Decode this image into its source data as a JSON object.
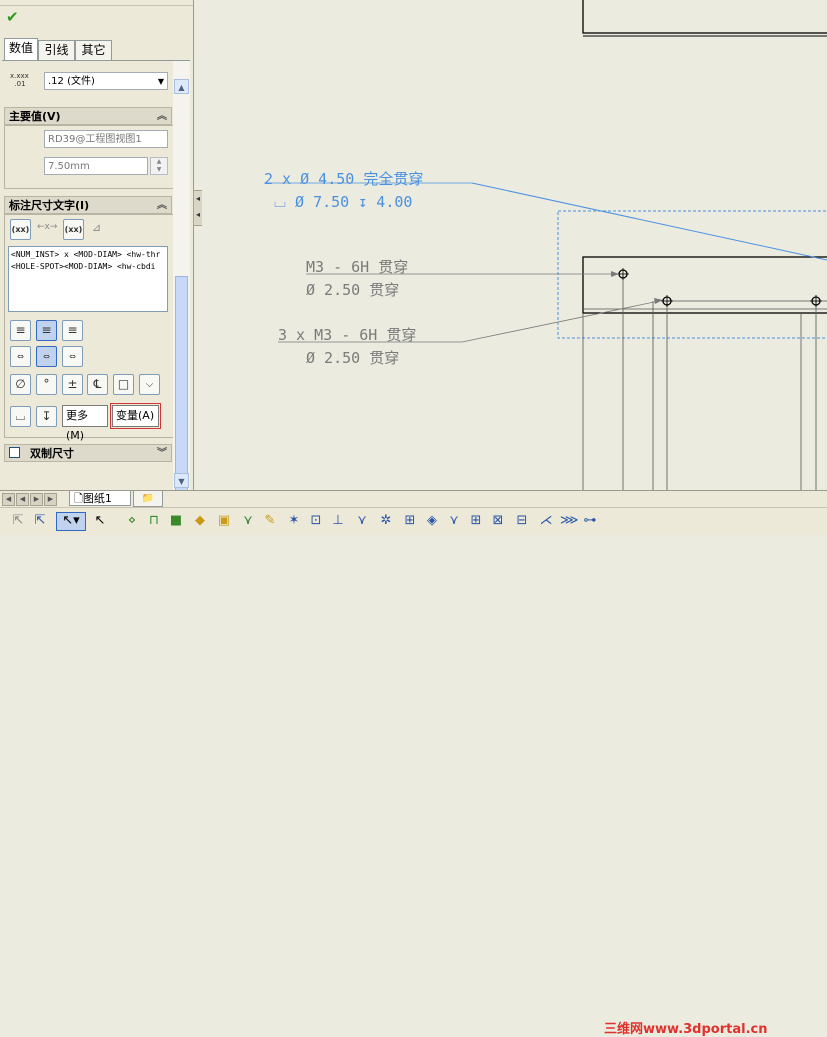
{
  "panel": {
    "tabs": [
      {
        "label": "数值",
        "active": true
      },
      {
        "label": "引线",
        "active": false
      },
      {
        "label": "其它",
        "active": false
      }
    ],
    "tolerance": {
      "icon_text": "x.xxx .01",
      "value": ".12 (文件)"
    },
    "primary_value": {
      "title": "主要值(V)",
      "reference": "RD39@工程图视图1",
      "value": "7.50mm"
    },
    "dim_text": {
      "title": "标注尺寸文字(I)",
      "xx_label": "(xx)",
      "text_lines": [
        "<NUM_INST> x <MOD-DIAM> <hw-thr",
        "<HOLE-SPOT><MOD-DIAM> <hw-cbdi"
      ],
      "more_button": "更多(M)",
      "variables_button": "变量(A)"
    },
    "dual_dim": {
      "title": "双制尺寸"
    }
  },
  "drawing": {
    "callout1": {
      "line1": "2 x Ø 4.50 完全贯穿",
      "line2": "⌴ Ø 7.50 ↧ 4.00"
    },
    "callout2": {
      "line1": "M3 - 6H 贯穿",
      "line2": "Ø 2.50 贯穿"
    },
    "callout3": {
      "line1": "3 x  M3 - 6H 贯穿",
      "line2": "Ø 2.50 贯穿"
    },
    "colors": {
      "selected": "#4a90e0",
      "normal": "#7a7a7a",
      "geometry": "#000000"
    }
  },
  "sheets": {
    "active": "图纸1"
  },
  "watermark": "三维网www.3dportal.cn"
}
